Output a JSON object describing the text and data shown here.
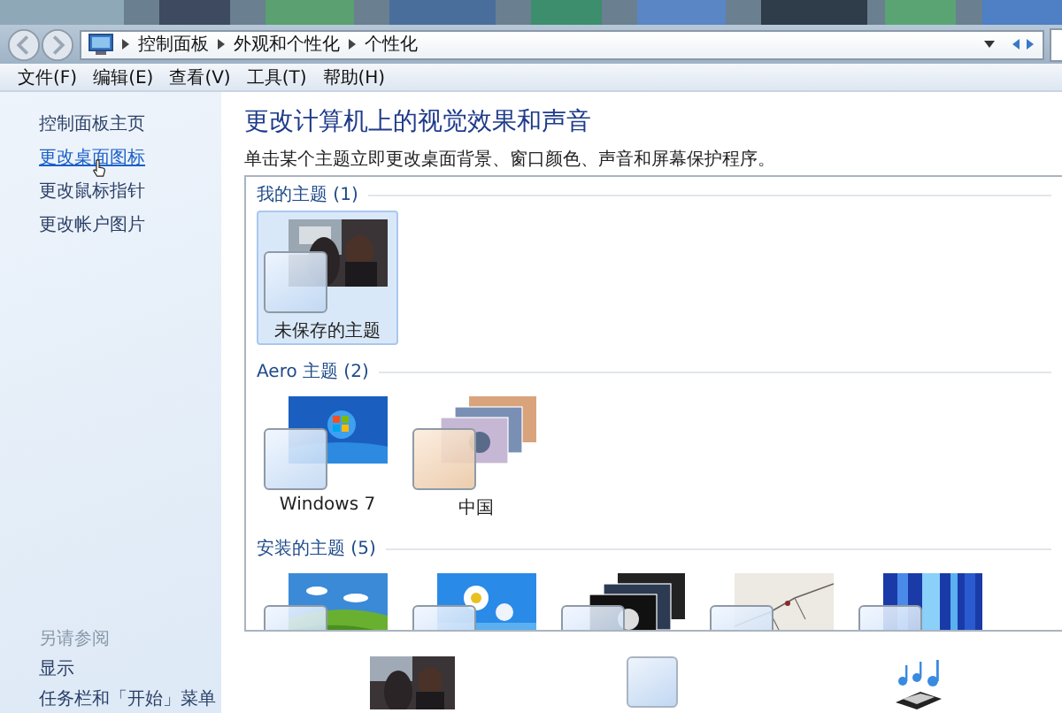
{
  "address_bar": {
    "breadcrumb": [
      "控制面板",
      "外观和个性化",
      "个性化"
    ]
  },
  "menu_bar": [
    "文件(F)",
    "编辑(E)",
    "查看(V)",
    "工具(T)",
    "帮助(H)"
  ],
  "sidebar": {
    "links": [
      {
        "label": "控制面板主页",
        "hovered": false
      },
      {
        "label": "更改桌面图标",
        "hovered": true
      },
      {
        "label": "更改鼠标指针",
        "hovered": false
      },
      {
        "label": "更改帐户图片",
        "hovered": false
      }
    ],
    "see_also": {
      "title": "另请参阅",
      "links": [
        "显示",
        "任务栏和「开始」菜单"
      ]
    }
  },
  "main": {
    "title": "更改计算机上的视觉效果和声音",
    "description": "单击某个主题立即更改桌面背景、窗口颜色、声音和屏幕保护程序。",
    "theme_groups": [
      {
        "title": "我的主题 (1)",
        "themes": [
          {
            "label": "未保存的主题",
            "selected": true
          }
        ]
      },
      {
        "title": "Aero 主题 (2)",
        "themes": [
          {
            "label": "Windows 7",
            "selected": false
          },
          {
            "label": "中国",
            "selected": false
          }
        ]
      },
      {
        "title": "安装的主题 (5)",
        "themes": [
          {
            "selected": false
          },
          {
            "selected": false
          },
          {
            "selected": false
          },
          {
            "selected": false
          },
          {
            "selected": false
          }
        ]
      }
    ]
  },
  "bottom_settings": [
    {
      "kind": "picture"
    },
    {
      "kind": "color"
    },
    {
      "kind": "sound"
    }
  ]
}
